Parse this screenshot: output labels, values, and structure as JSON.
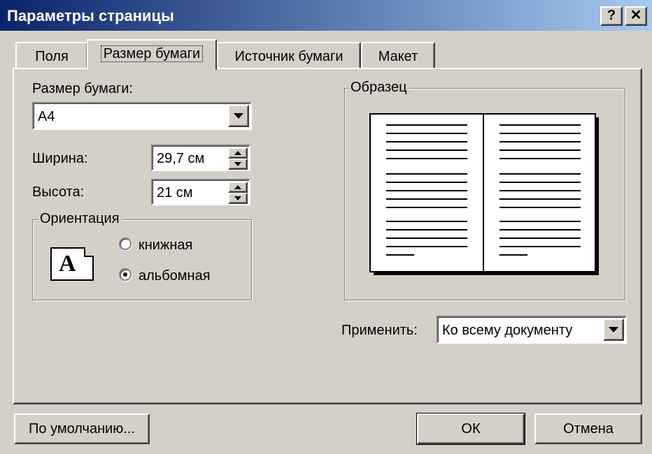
{
  "window": {
    "title": "Параметры страницы",
    "help_label": "?",
    "close_label": "✕"
  },
  "tabs": [
    {
      "label": "Поля",
      "active": false
    },
    {
      "label": "Размер бумаги",
      "active": true
    },
    {
      "label": "Источник бумаги",
      "active": false
    },
    {
      "label": "Макет",
      "active": false
    }
  ],
  "paper": {
    "size_label": "Размер бумаги:",
    "size_value": "A4",
    "width_label": "Ширина:",
    "width_value": "29,7 см",
    "height_label": "Высота:",
    "height_value": "21 см"
  },
  "orientation": {
    "legend": "Ориентация",
    "icon_letter": "A",
    "portrait_label": "книжная",
    "landscape_label": "альбомная",
    "selected": "landscape"
  },
  "preview": {
    "legend": "Образец"
  },
  "apply": {
    "label": "Применить:",
    "value": "Ко всему документу"
  },
  "buttons": {
    "default_label": "По умолчанию...",
    "ok_label": "ОК",
    "cancel_label": "Отмена"
  }
}
